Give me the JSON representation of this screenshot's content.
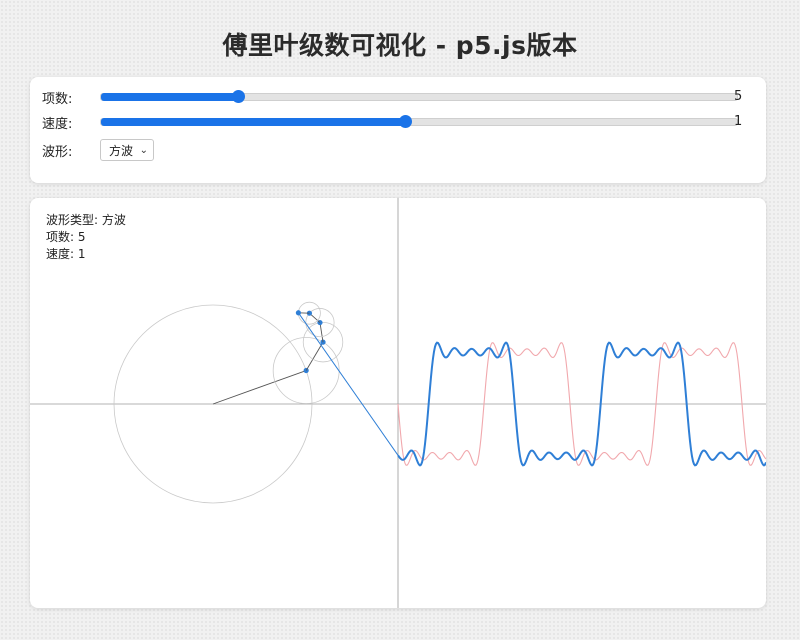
{
  "title": "傅里叶级数可视化 - p5.js版本",
  "controls": {
    "terms": {
      "label": "项数:",
      "value": 5,
      "fraction": 0.215,
      "value_text": "5"
    },
    "speed": {
      "label": "速度:",
      "value": 1,
      "fraction": 0.478,
      "value_text": "1"
    },
    "waveform": {
      "label": "波形:",
      "selected": "方波"
    }
  },
  "canvas": {
    "info_waveform": "波形类型: 方波",
    "info_terms": "项数: 5",
    "info_speed": "速度: 1"
  },
  "colors": {
    "accent": "#1a73e8",
    "wave": "#2f7fd6",
    "wave_ghost": "#f1a8ad",
    "axis": "#9a9a9a",
    "circle": "#c9c9c9"
  },
  "chart_data": {
    "type": "line",
    "waveform": "square",
    "terms": 5,
    "series": [
      {
        "values": "Fourier partial sum of square wave with harmonics 1,3,5,7,9"
      }
    ]
  }
}
